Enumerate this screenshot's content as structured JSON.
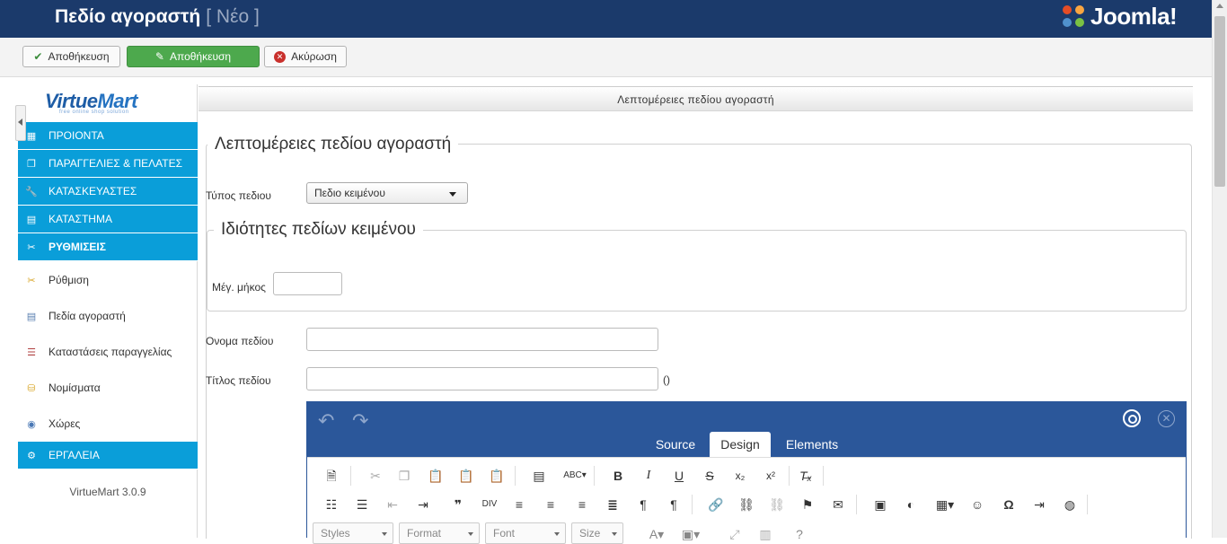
{
  "header": {
    "title": "Πεδίο αγοραστή",
    "subtitle": "[ Νέο ]",
    "logo_text": "Joomla!"
  },
  "toolbar": {
    "save_label": "Αποθήκευση",
    "save_close_label": "Αποθήκευση",
    "cancel_label": "Ακύρωση"
  },
  "sidebar": {
    "logo_main": "Virtue",
    "logo_mart": "Mart",
    "logo_tagline": "free online shop solution",
    "menu": [
      {
        "label": "ΠΡΟΙΟΝΤΑ",
        "icon": "products-icon"
      },
      {
        "label": "ΠΑΡΑΓΓΕΛΙΕΣ & ΠΕΛΑΤΕΣ",
        "icon": "orders-icon"
      },
      {
        "label": "ΚΑΤΑΣΚΕΥΑΣΤΕΣ",
        "icon": "manufacturers-icon"
      },
      {
        "label": "ΚΑΤΑΣΤΗΜΑ",
        "icon": "shop-icon"
      },
      {
        "label": "ΡΥΘΜΙΣΕΙΣ",
        "icon": "settings-icon"
      }
    ],
    "submenu": [
      {
        "label": "Ρύθμιση",
        "icon": "configuration-icon"
      },
      {
        "label": "Πεδία αγοραστή",
        "icon": "shopper-fields-icon"
      },
      {
        "label": "Καταστάσεις παραγγελίας",
        "icon": "order-status-icon"
      },
      {
        "label": "Νομίσματα",
        "icon": "currencies-icon"
      },
      {
        "label": "Χώρες",
        "icon": "countries-icon"
      }
    ],
    "tools_label": "ΕΡΓΑΛΕΙΑ",
    "version": "VirtueMart 3.0.9"
  },
  "panel": {
    "header": "Λεπτομέρειες πεδίου αγοραστή",
    "legend": "Λεπτομέρειες πεδίου αγοραστή",
    "field_type_label": "Τύπος πεδιου",
    "field_type_value": "Πεδιο κειμένου",
    "text_props_legend": "Ιδιότητες πεδίων κειμένου",
    "max_length_label": "Μέγ. μήκος",
    "max_length_value": "",
    "field_name_label": "Ονομα πεδίου",
    "field_name_value": "",
    "field_title_label": "Τίτλος πεδίου",
    "field_title_value": "",
    "field_title_suffix": "()"
  },
  "editor": {
    "tabs": [
      "Source",
      "Design",
      "Elements"
    ],
    "active_tab": "Design",
    "combos": [
      "Styles",
      "Format",
      "Font",
      "Size"
    ]
  }
}
